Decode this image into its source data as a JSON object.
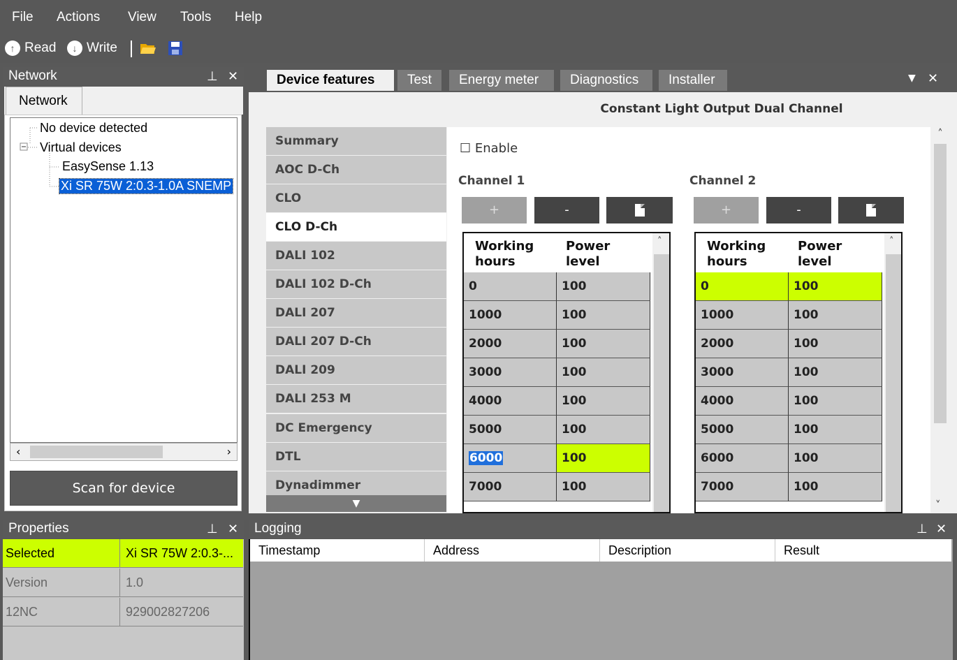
{
  "menu": [
    "File",
    "Actions",
    "View",
    "Tools",
    "Help"
  ],
  "toolbar": {
    "read": "Read",
    "write": "Write"
  },
  "network_panel": {
    "title": "Network",
    "tab": "Network",
    "tree": [
      "No device detected",
      "Virtual devices",
      "EasySense 1.13",
      "Xi SR 75W 2:0.3-1.0A SNEMP"
    ],
    "scan_button": "Scan for device"
  },
  "tabs": [
    "Device features",
    "Test",
    "Energy meter",
    "Diagnostics",
    "Installer"
  ],
  "main_title": "Constant Light Output Dual Channel",
  "features": [
    "Summary",
    "AOC D-Ch",
    "CLO",
    "CLO D-Ch",
    "DALI 102",
    "DALI 102 D-Ch",
    "DALI 207",
    "DALI 207 D-Ch",
    "DALI 209",
    "DALI 253 M",
    "DC Emergency",
    "DTL",
    "Dynadimmer"
  ],
  "active_feature": "CLO D-Ch",
  "enable_label": "Enable",
  "channel1": {
    "label": "Channel 1",
    "col_hours": "Working hours",
    "col_power": "Power level",
    "rows": [
      [
        "0",
        "100"
      ],
      [
        "1000",
        "100"
      ],
      [
        "2000",
        "100"
      ],
      [
        "3000",
        "100"
      ],
      [
        "4000",
        "100"
      ],
      [
        "5000",
        "100"
      ],
      [
        "6000",
        "100"
      ],
      [
        "7000",
        "100"
      ]
    ]
  },
  "channel2": {
    "label": "Channel 2",
    "col_hours": "Working hours",
    "col_power": "Power level",
    "rows": [
      [
        "0",
        "100"
      ],
      [
        "1000",
        "100"
      ],
      [
        "2000",
        "100"
      ],
      [
        "3000",
        "100"
      ],
      [
        "4000",
        "100"
      ],
      [
        "5000",
        "100"
      ],
      [
        "6000",
        "100"
      ],
      [
        "7000",
        "100"
      ]
    ]
  },
  "buttons": {
    "plus": "+",
    "minus": "-"
  },
  "properties": {
    "title": "Properties",
    "rows": [
      [
        "Selected",
        "Xi SR 75W 2:0.3-..."
      ],
      [
        "Version",
        "1.0"
      ],
      [
        "12NC",
        "929002827206"
      ]
    ]
  },
  "logging": {
    "title": "Logging",
    "columns": [
      "Timestamp",
      "Address",
      "Description",
      "Result"
    ]
  },
  "colors": {
    "highlight": "#ccff00",
    "selection": "#0a5fd6",
    "chrome": "#585858"
  }
}
